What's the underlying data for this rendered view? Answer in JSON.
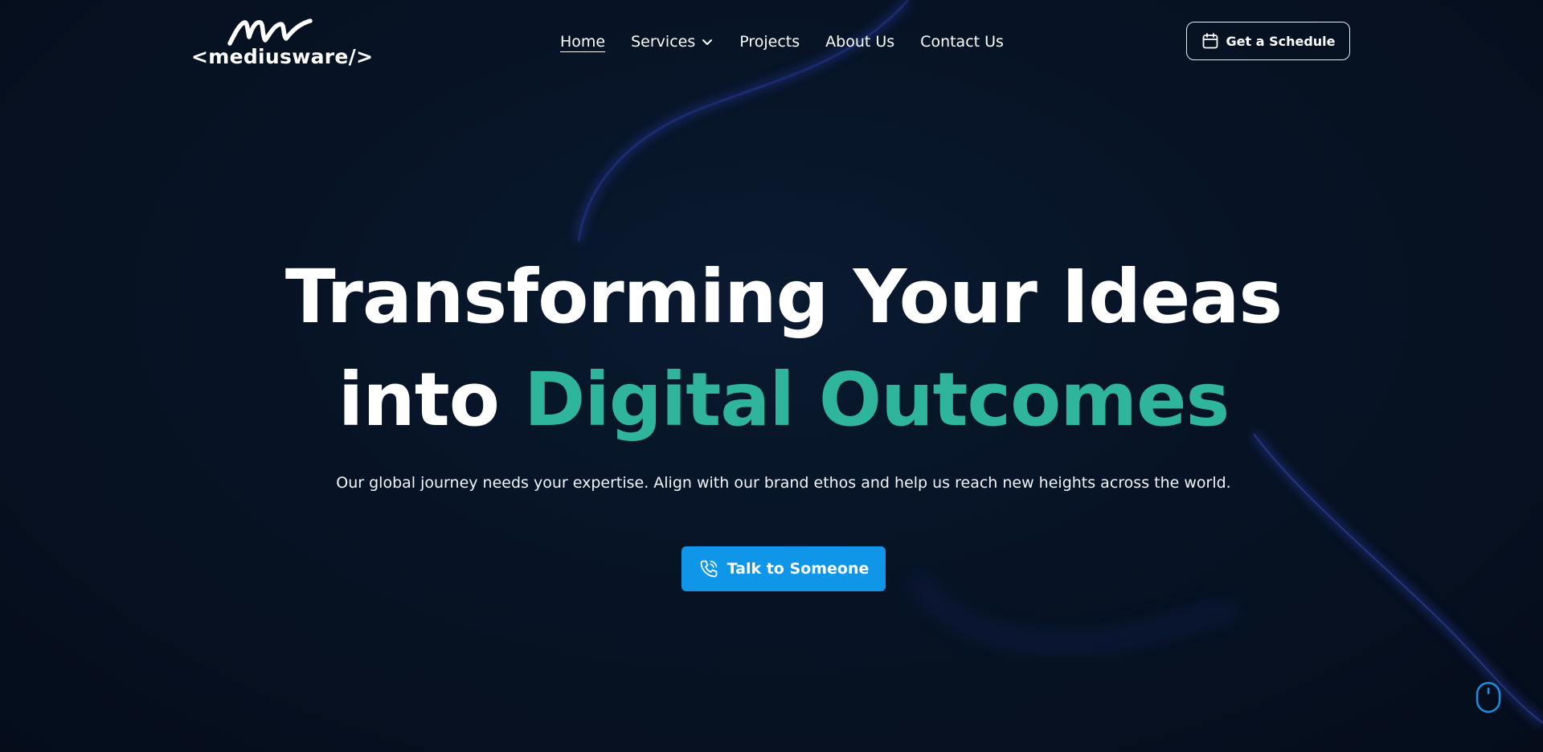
{
  "colors": {
    "background": "#061020",
    "accent_green": "#2fb59c",
    "cta_blue": "#0f96e8",
    "text_white": "#ffffff"
  },
  "header": {
    "logo_text": "<mediusware/>",
    "logo_icon": "mw-signature-mark",
    "nav": {
      "home": "Home",
      "services": "Services",
      "projects": "Projects",
      "about": "About Us",
      "contact": "Contact Us"
    },
    "schedule_button": {
      "label": "Get a Schedule",
      "icon": "calendar-icon"
    }
  },
  "hero": {
    "title_line1": "Transforming Your Ideas",
    "title_line2_plain": "into",
    "title_line2_accent": "Digital Outcomes",
    "subtitle": "Our global journey needs your expertise. Align with our brand ethos and help us reach new heights across the world.",
    "cta": {
      "label": "Talk to Someone",
      "icon": "phone-icon"
    }
  },
  "scroll_indicator": {
    "icon": "mouse-scroll-icon"
  }
}
